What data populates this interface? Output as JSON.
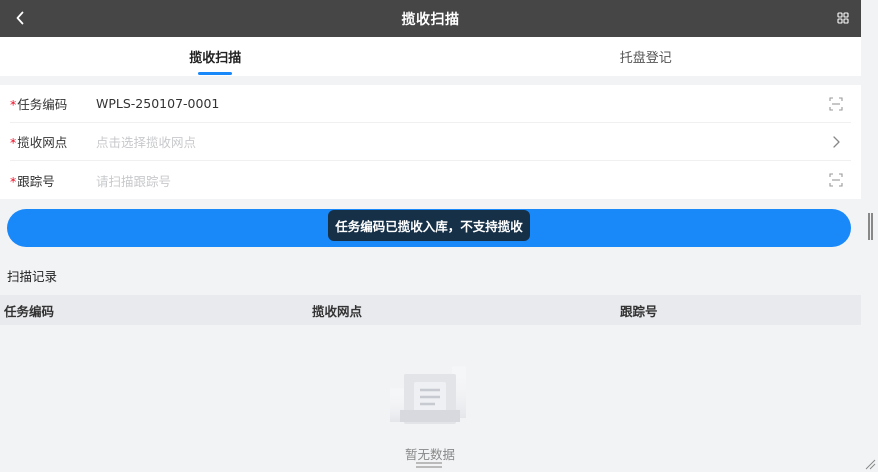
{
  "header": {
    "title": "揽收扫描",
    "back_icon": "chevron-left-icon",
    "menu_icon": "grid-icon"
  },
  "tabs": [
    {
      "label": "揽收扫描",
      "active": true
    },
    {
      "label": "托盘登记",
      "active": false
    }
  ],
  "form": {
    "task_code": {
      "required_mark": "*",
      "label": "任务编码",
      "value": "WPLS-250107-0001",
      "icon": "scan-icon"
    },
    "site": {
      "required_mark": "*",
      "label": "揽收网点",
      "placeholder": "点击选择揽收网点",
      "icon": "chevron-right-icon"
    },
    "tracking": {
      "required_mark": "*",
      "label": "跟踪号",
      "placeholder": "请扫描跟踪号",
      "icon": "scan-icon"
    }
  },
  "toast": {
    "message": "任务编码已揽收入库，不支持揽收"
  },
  "records": {
    "title": "扫描记录",
    "columns": [
      "任务编码",
      "揽收网点",
      "跟踪号"
    ],
    "empty_text": "暂无数据"
  },
  "colors": {
    "primary": "#1989fa",
    "header_bg": "#464646",
    "required": "#ee0a24",
    "toast_bg": "#163048"
  }
}
